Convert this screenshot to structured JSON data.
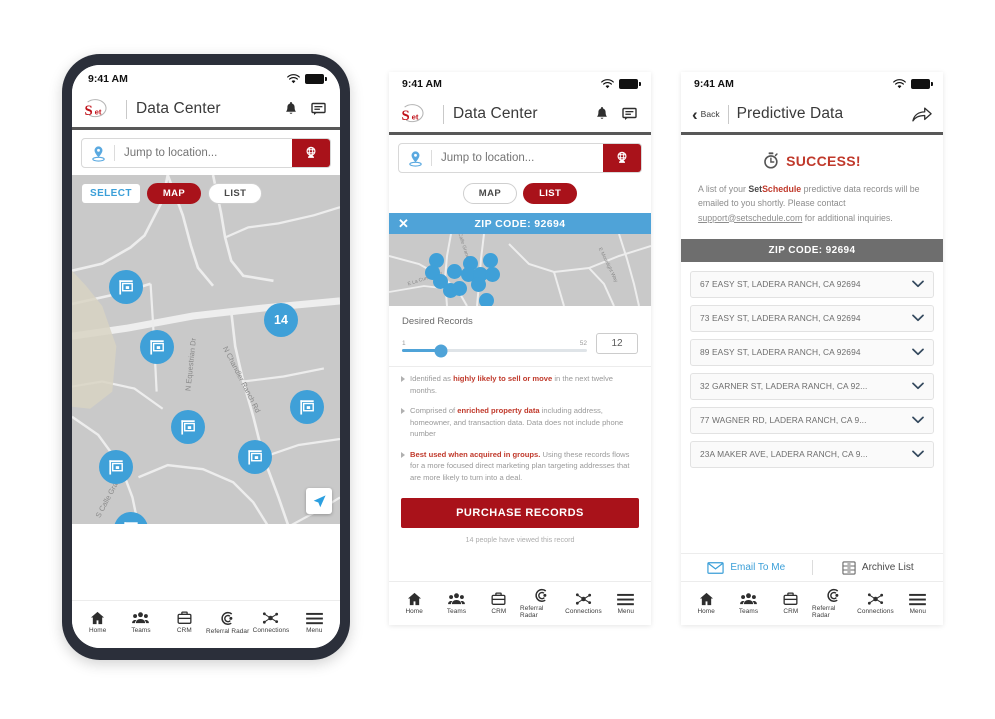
{
  "status_bar": {
    "time": "9:41 AM",
    "wifi_icon": "wifi-icon",
    "battery_icon": "battery-icon"
  },
  "brand": {
    "logo_text_s": "S",
    "logo_text_et": "et",
    "accent_red": "#a9121a",
    "accent_blue": "#4fa3d8",
    "text_red": "#c0392b"
  },
  "phone1": {
    "header": {
      "title": "Data Center",
      "bell_icon": "bell-icon",
      "chat_icon": "chat-icon",
      "logo_icon": "setschedule-logo-icon"
    },
    "search": {
      "placeholder": "Jump to location...",
      "pin_icon": "location-pin-icon",
      "globe_icon": "globe-icon"
    },
    "map_controls": {
      "select_label": "SELECT",
      "map_label": "MAP",
      "list_label": "LIST",
      "active": "MAP",
      "navigate_icon": "navigate-arrow-icon"
    },
    "map": {
      "cluster_count": "14",
      "marker_icon": "for-sale-sign-icon",
      "street_labels": [
        "N Equestrian Dr",
        "N Chandler Ranch Rd",
        "S Calle Grande",
        "N Ch"
      ]
    },
    "tabs": [
      {
        "label": "Home",
        "icon": "home-icon"
      },
      {
        "label": "Teams",
        "icon": "people-icon"
      },
      {
        "label": "CRM",
        "icon": "briefcase-icon"
      },
      {
        "label": "Referral Radar",
        "icon": "radar-icon"
      },
      {
        "label": "Connections",
        "icon": "network-icon"
      },
      {
        "label": "Menu",
        "icon": "hamburger-icon"
      }
    ]
  },
  "phone2": {
    "header": {
      "title": "Data Center",
      "bell_icon": "bell-icon",
      "chat_icon": "chat-icon",
      "logo_icon": "setschedule-logo-icon"
    },
    "search": {
      "placeholder": "Jump to location...",
      "pin_icon": "location-pin-icon",
      "globe_icon": "globe-icon"
    },
    "map_controls": {
      "map_label": "MAP",
      "list_label": "LIST",
      "active": "LIST"
    },
    "card": {
      "close_icon": "close-x-icon",
      "zip_title": "ZIP CODE: 92694",
      "map_street_labels": [
        "E La Cumbre Dr",
        "S Calle Grande",
        "E Moonlight Way",
        "ence Dr"
      ],
      "slider": {
        "label": "Desired Records",
        "min": "1",
        "max": "52",
        "value": "12",
        "percent": 21
      },
      "bullets": [
        {
          "pre": "Identified as ",
          "strong": "highly likely to sell or move",
          "post": " in the next twelve months."
        },
        {
          "pre": "Comprised of ",
          "strong": "enriched property data",
          "post": " including address, homeowner, and transaction data. Data does not include phone number"
        },
        {
          "pre": "",
          "strong": "Best used when acquired in groups.",
          "post": " Using these records flows for a more focused direct marketing plan targeting addresses that are more likely to turn into a deal."
        }
      ],
      "purchase_label": "PURCHASE RECORDS",
      "viewed_text": "14 people have viewed this record"
    },
    "tabs": [
      {
        "label": "Home",
        "icon": "home-icon"
      },
      {
        "label": "Teams",
        "icon": "people-icon"
      },
      {
        "label": "CRM",
        "icon": "briefcase-icon"
      },
      {
        "label": "Referral Radar",
        "icon": "radar-icon"
      },
      {
        "label": "Connections",
        "icon": "network-icon"
      },
      {
        "label": "Menu",
        "icon": "hamburger-icon"
      }
    ]
  },
  "phone3": {
    "header": {
      "back_label": "Back",
      "back_icon": "chevron-left-icon",
      "title": "Predictive Data",
      "share_icon": "share-arrow-icon"
    },
    "success": {
      "icon": "stopwatch-icon",
      "label": "SUCCESS!"
    },
    "message": {
      "part1": "A list of your ",
      "brand_dark": "Set",
      "brand_red": "Schedule",
      "part2": " predictive data records will be emailed to you shortly. Please contact ",
      "email": "support@setschedule.com",
      "part3": " for additional inquiries."
    },
    "zip_title": "ZIP CODE: 92694",
    "addresses": [
      "67 EASY ST, LADERA RANCH, CA 92694",
      "73 EASY ST, LADERA RANCH, CA 92694",
      "89 EASY ST, LADERA RANCH, CA 92694",
      "32 GARNER ST, LADERA RANCH, CA 92...",
      "77 WAGNER RD, LADERA RANCH, CA 9...",
      "23A MAKER AVE, LADERA RANCH, CA 9..."
    ],
    "row_chevron_icon": "chevron-down-icon",
    "actions": {
      "email_label": "Email To Me",
      "email_icon": "envelope-icon",
      "archive_label": "Archive List",
      "archive_icon": "archive-box-icon"
    },
    "tabs": [
      {
        "label": "Home",
        "icon": "home-icon"
      },
      {
        "label": "Teams",
        "icon": "people-icon"
      },
      {
        "label": "CRM",
        "icon": "briefcase-icon"
      },
      {
        "label": "Referral Radar",
        "icon": "radar-icon"
      },
      {
        "label": "Connections",
        "icon": "network-icon"
      },
      {
        "label": "Menu",
        "icon": "hamburger-icon"
      }
    ]
  }
}
